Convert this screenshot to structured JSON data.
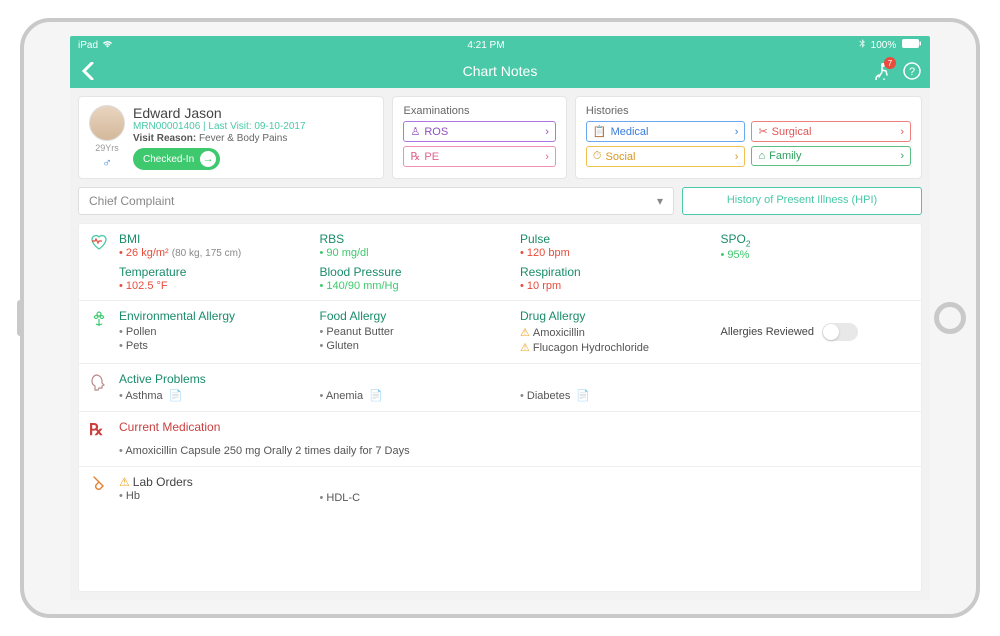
{
  "statusbar": {
    "device": "iPad",
    "time": "4:21 PM",
    "battery": "100%"
  },
  "navbar": {
    "title": "Chart Notes",
    "badge": "7"
  },
  "patient": {
    "name": "Edward Jason",
    "mrn": "MRN00001406 | Last Visit: 09-10-2017",
    "reason_label": "Visit Reason:",
    "reason": "Fever & Body Pains",
    "age": "29Yrs",
    "gender": "♂",
    "status": "Checked-In"
  },
  "examinations": {
    "title": "Examinations",
    "items": [
      {
        "label": "ROS",
        "style": "purple"
      },
      {
        "label": "PE",
        "style": "pink"
      }
    ]
  },
  "histories": {
    "title": "Histories",
    "items": [
      {
        "label": "Medical",
        "style": "blue"
      },
      {
        "label": "Social",
        "style": "yellow"
      },
      {
        "label": "Surgical",
        "style": "red"
      },
      {
        "label": "Family",
        "style": "green"
      }
    ]
  },
  "complaint": {
    "placeholder": "Chief Complaint",
    "hpi": "History of Present Illness (HPI)"
  },
  "vitals": [
    {
      "label": "BMI",
      "value": "26 kg/m²",
      "meta": "(80 kg, 175 cm)",
      "color": "red",
      "label2": "Temperature",
      "value2": "102.5 °F",
      "color2": "red"
    },
    {
      "label": "RBS",
      "value": "90 mg/dl",
      "color": "green",
      "label2": "Blood Pressure",
      "value2": "140/90 mm/Hg",
      "color2": "green"
    },
    {
      "label": "Pulse",
      "value": "120 bpm",
      "color": "red",
      "label2": "Respiration",
      "value2": "10 rpm",
      "color2": "red"
    },
    {
      "label": "SPO₂",
      "value": "95%",
      "color": "green"
    }
  ],
  "allergies": {
    "env": {
      "title": "Environmental Allergy",
      "items": [
        "Pollen",
        "Pets"
      ]
    },
    "food": {
      "title": "Food Allergy",
      "items": [
        "Peanut Butter",
        "Gluten"
      ]
    },
    "drug": {
      "title": "Drug Allergy",
      "items": [
        "Amoxicillin",
        "Flucagon Hydrochloride"
      ]
    },
    "reviewed_label": "Allergies Reviewed"
  },
  "problems": {
    "title": "Active Problems",
    "items": [
      "Asthma",
      "Anemia",
      "Diabetes"
    ]
  },
  "medication": {
    "title": "Current Medication",
    "text": "Amoxicillin Capsule 250 mg Orally 2 times daily for 7 Days"
  },
  "labs": {
    "title": "Lab Orders",
    "items": [
      "Hb",
      "HDL-C"
    ]
  }
}
